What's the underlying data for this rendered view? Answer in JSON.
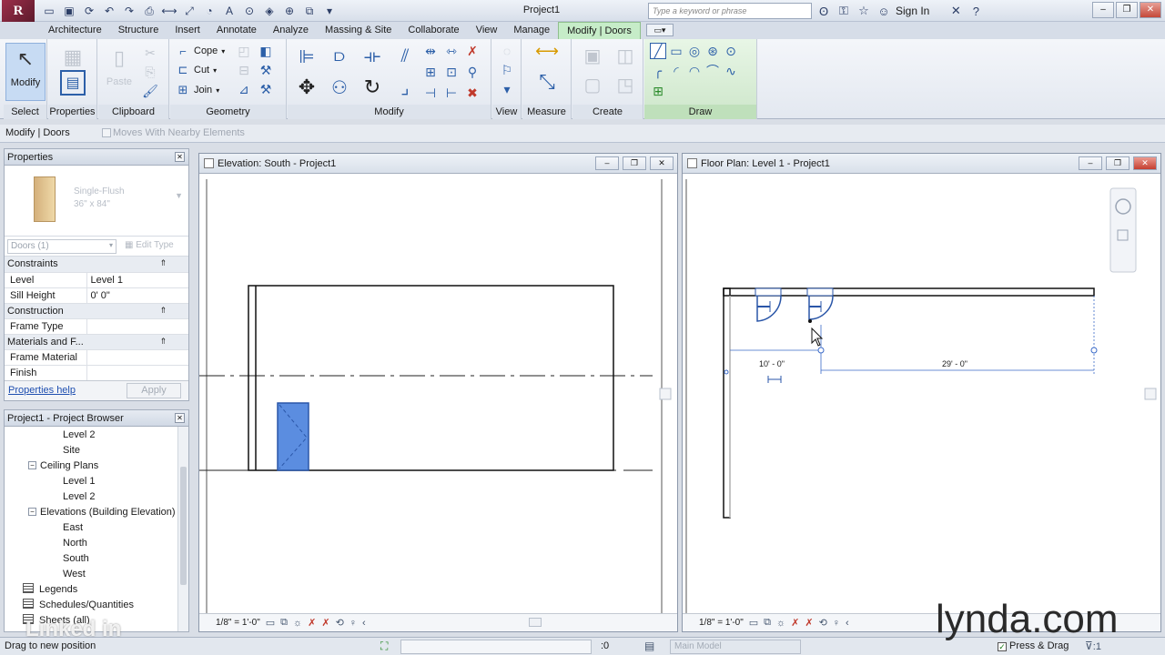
{
  "app": {
    "logo_letter": "R",
    "title": "Project1",
    "search_placeholder": "Type a keyword or phrase",
    "sign_in": "Sign In"
  },
  "ribbon": {
    "tabs": [
      "Architecture",
      "Structure",
      "Insert",
      "Annotate",
      "Analyze",
      "Massing & Site",
      "Collaborate",
      "View",
      "Manage",
      "Modify | Doors"
    ],
    "active_tab": "Modify | Doors",
    "panels": {
      "select": {
        "label": "Select",
        "modify_label": "Modify"
      },
      "properties": {
        "label": "Properties"
      },
      "clipboard": {
        "label": "Clipboard",
        "paste_label": "Paste"
      },
      "geometry": {
        "label": "Geometry",
        "cope": "Cope",
        "cut": "Cut",
        "join": "Join"
      },
      "modify": {
        "label": "Modify"
      },
      "view": {
        "label": "View"
      },
      "measure": {
        "label": "Measure"
      },
      "create": {
        "label": "Create"
      },
      "draw": {
        "label": "Draw"
      }
    }
  },
  "options_bar": {
    "context": "Modify | Doors",
    "moves_with": "Moves With Nearby Elements"
  },
  "properties": {
    "title": "Properties",
    "type_name_line1": "Single-Flush",
    "type_name_line2": "36\" x 84\"",
    "instance_filter": "Doors (1)",
    "edit_type": "Edit Type",
    "rows": [
      {
        "kind": "group",
        "label": "Constraints"
      },
      {
        "kind": "prop",
        "label": "Level",
        "value": "Level 1"
      },
      {
        "kind": "prop",
        "label": "Sill Height",
        "value": "0'  0\""
      },
      {
        "kind": "group",
        "label": "Construction"
      },
      {
        "kind": "prop",
        "label": "Frame Type",
        "value": ""
      },
      {
        "kind": "group",
        "label": "Materials and F..."
      },
      {
        "kind": "prop",
        "label": "Frame Material",
        "value": ""
      },
      {
        "kind": "prop",
        "label": "Finish",
        "value": ""
      }
    ],
    "help_link": "Properties help",
    "apply": "Apply"
  },
  "project_browser": {
    "title": "Project1 - Project Browser",
    "items": [
      {
        "label": "Level 2",
        "indent": 3,
        "toggle": ""
      },
      {
        "label": "Site",
        "indent": 3,
        "toggle": ""
      },
      {
        "label": "Ceiling Plans",
        "indent": 2,
        "toggle": "−"
      },
      {
        "label": "Level 1",
        "indent": 3,
        "toggle": ""
      },
      {
        "label": "Level 2",
        "indent": 3,
        "toggle": ""
      },
      {
        "label": "Elevations (Building Elevation)",
        "indent": 2,
        "toggle": "−"
      },
      {
        "label": "East",
        "indent": 3,
        "toggle": ""
      },
      {
        "label": "North",
        "indent": 3,
        "toggle": ""
      },
      {
        "label": "South",
        "indent": 3,
        "toggle": ""
      },
      {
        "label": "West",
        "indent": 3,
        "toggle": ""
      },
      {
        "label": "Legends",
        "indent": 1,
        "toggle": "icon"
      },
      {
        "label": "Schedules/Quantities",
        "indent": 1,
        "toggle": "icon"
      },
      {
        "label": "Sheets (all)",
        "indent": 1,
        "toggle": "icon"
      }
    ]
  },
  "views": {
    "elevation": {
      "title": "Elevation: South - Project1",
      "scale": "1/8\" = 1'-0\""
    },
    "floorplan": {
      "title": "Floor Plan: Level 1 - Project1",
      "scale": "1/8\" = 1'-0\"",
      "dim_left": "10' - 0\"",
      "dim_right": "29' - 0\""
    }
  },
  "status": {
    "text": "Drag to new position",
    "zero": ":0",
    "model": "Main Model",
    "press_drag": "Press & Drag",
    "filter_count": ":1"
  },
  "watermarks": {
    "lynda": "lynda.com",
    "linkedin": "Linked in"
  },
  "colors": {
    "active_tab": "#c6ecc8",
    "selection": "#4a7fd4",
    "accent": "#2c5fa8"
  }
}
